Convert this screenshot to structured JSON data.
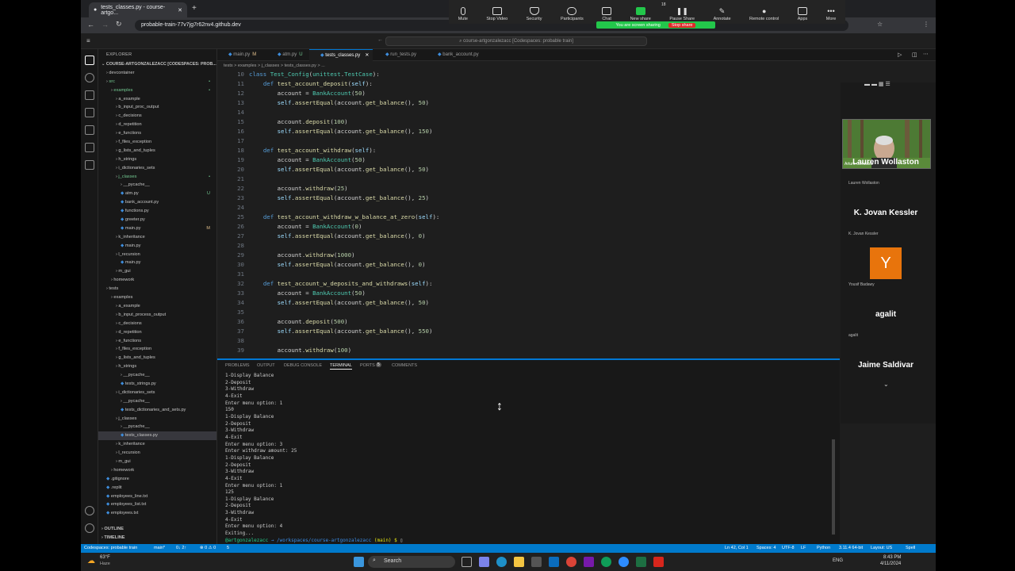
{
  "browser": {
    "tab_title": "tests_classes.py - course-artgo...",
    "url": "probable-train-77v7jg7r62nv4.github.dev"
  },
  "zoom": {
    "items": [
      "Mute",
      "Stop Video",
      "Security",
      "Participants",
      "Chat",
      "New share",
      "Pause Share",
      "Annotate",
      "Remote control",
      "Apps",
      "More"
    ],
    "participants_count": "18",
    "sharing_label": "You are screen sharing",
    "stop_share": "Stop share"
  },
  "vscode": {
    "command_center": "course-artgonzalezacc [Codespaces: probable train]",
    "explorer_title": "EXPLORER",
    "workspace": "COURSE-ARTGONZALEZACC [CODESPACES: PROB...",
    "tree": [
      {
        "label": "devcontainer",
        "indent": 1,
        "type": "folder"
      },
      {
        "label": "src",
        "indent": 1,
        "type": "folder",
        "mark": "•"
      },
      {
        "label": "examples",
        "indent": 2,
        "type": "folder",
        "mark": "•"
      },
      {
        "label": "a_example",
        "indent": 3,
        "type": "folder"
      },
      {
        "label": "b_input_proc_output",
        "indent": 3,
        "type": "folder"
      },
      {
        "label": "c_decisions",
        "indent": 3,
        "type": "folder"
      },
      {
        "label": "d_repetition",
        "indent": 3,
        "type": "folder"
      },
      {
        "label": "e_functions",
        "indent": 3,
        "type": "folder"
      },
      {
        "label": "f_files_exception",
        "indent": 3,
        "type": "folder"
      },
      {
        "label": "g_lists_and_tuples",
        "indent": 3,
        "type": "folder"
      },
      {
        "label": "h_strings",
        "indent": 3,
        "type": "folder"
      },
      {
        "label": "i_dictionaries_sets",
        "indent": 3,
        "type": "folder"
      },
      {
        "label": "j_classes",
        "indent": 3,
        "type": "folder",
        "mark": "•"
      },
      {
        "label": "__pycache__",
        "indent": 4,
        "type": "folder"
      },
      {
        "label": "atm.py",
        "indent": 4,
        "type": "file",
        "mark": "U"
      },
      {
        "label": "bank_account.py",
        "indent": 4,
        "type": "file"
      },
      {
        "label": "functions.py",
        "indent": 4,
        "type": "file"
      },
      {
        "label": "greeter.py",
        "indent": 4,
        "type": "file"
      },
      {
        "label": "main.py",
        "indent": 4,
        "type": "file",
        "mark": "M"
      },
      {
        "label": "k_inheritance",
        "indent": 3,
        "type": "folder"
      },
      {
        "label": "main.py",
        "indent": 4,
        "type": "file"
      },
      {
        "label": "l_recursion",
        "indent": 3,
        "type": "folder"
      },
      {
        "label": "main.py",
        "indent": 4,
        "type": "file"
      },
      {
        "label": "m_gui",
        "indent": 3,
        "type": "folder"
      },
      {
        "label": "homework",
        "indent": 2,
        "type": "folder"
      },
      {
        "label": "tests",
        "indent": 1,
        "type": "folder"
      },
      {
        "label": "examples",
        "indent": 2,
        "type": "folder"
      },
      {
        "label": "a_example",
        "indent": 3,
        "type": "folder"
      },
      {
        "label": "b_input_process_output",
        "indent": 3,
        "type": "folder"
      },
      {
        "label": "c_decisions",
        "indent": 3,
        "type": "folder"
      },
      {
        "label": "d_repetition",
        "indent": 3,
        "type": "folder"
      },
      {
        "label": "e_functions",
        "indent": 3,
        "type": "folder"
      },
      {
        "label": "f_files_exception",
        "indent": 3,
        "type": "folder"
      },
      {
        "label": "g_lists_and_tuples",
        "indent": 3,
        "type": "folder"
      },
      {
        "label": "h_strings",
        "indent": 3,
        "type": "folder"
      },
      {
        "label": "__pycache__",
        "indent": 4,
        "type": "folder"
      },
      {
        "label": "tests_strings.py",
        "indent": 4,
        "type": "file"
      },
      {
        "label": "i_dictionaries_sets",
        "indent": 3,
        "type": "folder"
      },
      {
        "label": "__pycache__",
        "indent": 4,
        "type": "folder"
      },
      {
        "label": "tests_dictionaries_and_sets.py",
        "indent": 4,
        "type": "file"
      },
      {
        "label": "j_classes",
        "indent": 3,
        "type": "folder"
      },
      {
        "label": "__pycache__",
        "indent": 4,
        "type": "folder"
      },
      {
        "label": "tests_classes.py",
        "indent": 4,
        "type": "file",
        "selected": true
      },
      {
        "label": "k_inheritance",
        "indent": 3,
        "type": "folder"
      },
      {
        "label": "l_recursion",
        "indent": 3,
        "type": "folder"
      },
      {
        "label": "m_gui",
        "indent": 3,
        "type": "folder"
      },
      {
        "label": "homework",
        "indent": 2,
        "type": "folder"
      },
      {
        "label": ".gitignore",
        "indent": 1,
        "type": "file"
      },
      {
        "label": ".replit",
        "indent": 1,
        "type": "file"
      },
      {
        "label": "employees_line.txt",
        "indent": 1,
        "type": "file"
      },
      {
        "label": "employees_list.txt",
        "indent": 1,
        "type": "file"
      },
      {
        "label": "employees.txt",
        "indent": 1,
        "type": "file"
      }
    ],
    "outline": "OUTLINE",
    "timeline": "TIMELINE",
    "tabs": [
      {
        "label": "main.py",
        "badge": "M"
      },
      {
        "label": "atm.py",
        "badge": "U"
      },
      {
        "label": "tests_classes.py",
        "badge": "",
        "active": true
      },
      {
        "label": "run_tests.py",
        "badge": ""
      },
      {
        "label": "bank_account.py",
        "badge": ""
      }
    ],
    "breadcrumb": "tests > examples > j_classes > tests_classes.py > ...",
    "code_lines": [
      {
        "n": "10",
        "t": "class Test_Config(unittest.TestCase):"
      },
      {
        "n": "11",
        "t": "    def test_account_deposit(self):"
      },
      {
        "n": "12",
        "t": "        account = BankAccount(50)"
      },
      {
        "n": "13",
        "t": "        self.assertEqual(account.get_balance(), 50)"
      },
      {
        "n": "14",
        "t": ""
      },
      {
        "n": "15",
        "t": "        account.deposit(100)"
      },
      {
        "n": "16",
        "t": "        self.assertEqual(account.get_balance(), 150)"
      },
      {
        "n": "17",
        "t": ""
      },
      {
        "n": "18",
        "t": "    def test_account_withdraw(self):"
      },
      {
        "n": "19",
        "t": "        account = BankAccount(50)"
      },
      {
        "n": "20",
        "t": "        self.assertEqual(account.get_balance(), 50)"
      },
      {
        "n": "21",
        "t": ""
      },
      {
        "n": "22",
        "t": "        account.withdraw(25)"
      },
      {
        "n": "23",
        "t": "        self.assertEqual(account.get_balance(), 25)"
      },
      {
        "n": "24",
        "t": ""
      },
      {
        "n": "25",
        "t": "    def test_account_withdraw_w_balance_at_zero(self):"
      },
      {
        "n": "26",
        "t": "        account = BankAccount(0)"
      },
      {
        "n": "27",
        "t": "        self.assertEqual(account.get_balance(), 0)"
      },
      {
        "n": "28",
        "t": ""
      },
      {
        "n": "29",
        "t": "        account.withdraw(1000)"
      },
      {
        "n": "30",
        "t": "        self.assertEqual(account.get_balance(), 0)"
      },
      {
        "n": "31",
        "t": ""
      },
      {
        "n": "32",
        "t": "    def test_account_w_deposits_and_withdraws(self):"
      },
      {
        "n": "33",
        "t": "        account = BankAccount(50)"
      },
      {
        "n": "34",
        "t": "        self.assertEqual(account.get_balance(), 50)"
      },
      {
        "n": "35",
        "t": ""
      },
      {
        "n": "36",
        "t": "        account.deposit(500)"
      },
      {
        "n": "37",
        "t": "        self.assertEqual(account.get_balance(), 550)"
      },
      {
        "n": "38",
        "t": ""
      },
      {
        "n": "39",
        "t": "        account.withdraw(100)"
      }
    ],
    "panel_tabs": [
      "PROBLEMS",
      "OUTPUT",
      "DEBUG CONSOLE",
      "TERMINAL",
      "PORTS",
      "COMMENTS"
    ],
    "ports_count": "5",
    "terminal_lines": [
      "1-Display Balance",
      "2-Deposit",
      "3-Withdraw",
      "4-Exit",
      "Enter menu option: 1",
      "150",
      "1-Display Balance",
      "2-Deposit",
      "3-Withdraw",
      "4-Exit",
      "Enter menu option: 3",
      "Enter withdraw amount: 25",
      "1-Display Balance",
      "2-Deposit",
      "3-Withdraw",
      "4-Exit",
      "Enter menu option: 1",
      "125",
      "1-Display Balance",
      "2-Deposit",
      "3-Withdraw",
      "4-Exit",
      "Enter menu option: 4",
      "Exiting..."
    ],
    "prompt_user": "@artgonzalezacc",
    "prompt_path": "→ /workspaces/course-artgonzalezacc",
    "prompt_branch": "(main) $",
    "status_left": [
      "Codespaces: probable train",
      "main*",
      "0↓ 2↑",
      "⊗ 0 ⚠ 0",
      "5"
    ],
    "status_right": [
      "Ln 42, Col 1",
      "Spaces: 4",
      "UTF-8",
      "LF",
      "Python",
      "3.11.4 64-bit",
      "Layout: US",
      "Spell"
    ]
  },
  "participants": [
    {
      "name": "Lauren Wollaston",
      "sub": "Lauren Wollaston"
    },
    {
      "name": "K. Jovan Kessler",
      "sub": "K. Jovan Kessler"
    },
    {
      "name": "",
      "sub": "Yousif Badawy",
      "avatar": "Y"
    },
    {
      "name": "agalit",
      "sub": "agalit"
    },
    {
      "name": "Jaime Saldivar",
      "sub": ""
    }
  ],
  "video_name": "Arturo Gonzalez",
  "taskbar": {
    "weather_temp": "63°F",
    "weather_text": "Haze",
    "search": "Search",
    "lang": "ENG",
    "time": "8:43 PM",
    "date": "4/11/2024"
  },
  "colors": {
    "accent": "#007acc",
    "zoom_green": "#23c74b",
    "stop_red": "#e02828",
    "avatar": "#e8740c"
  }
}
